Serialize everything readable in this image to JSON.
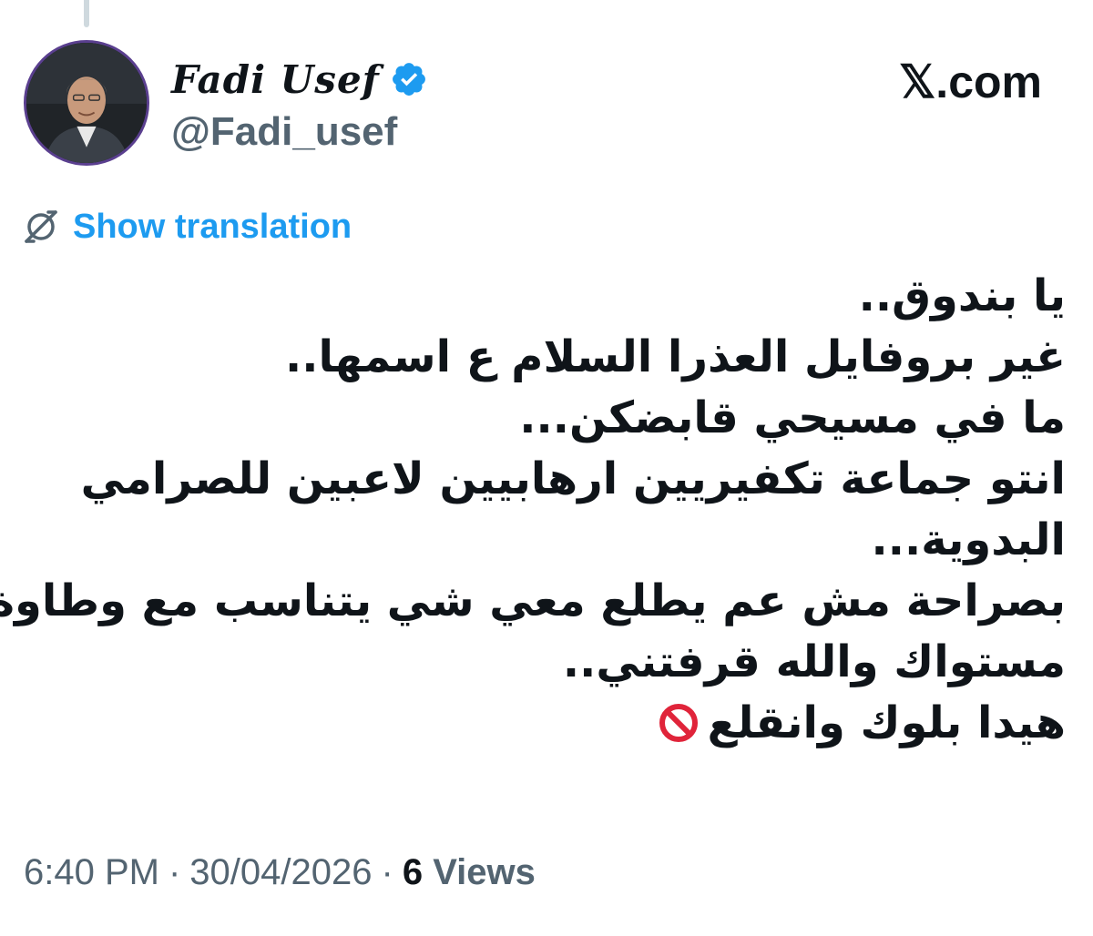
{
  "author": {
    "display_name": "Fadi Usef",
    "handle": "@Fadi_usef",
    "verified": true,
    "verified_icon": "verified-badge-icon",
    "avatar_icon": "profile-photo"
  },
  "brand": {
    "site": "𝕏.com"
  },
  "translation": {
    "label": "Show translation",
    "icon": "translate-icon"
  },
  "tweet": {
    "lines": [
      "يا بندوق..",
      "غير بروفايل العذرا السلام ع اسمها..",
      "ما في مسيحي قابضكن...",
      "انتو جماعة تكفيريين ارهابيين لاعبين للصرامي",
      "البدوية...",
      "بصراحة مش عم يطلع معي شي يتناسب مع وطاوة",
      "مستواك والله قرفتني..",
      "هيدا بلوك وانقلع"
    ],
    "trailing_emoji_icon": "prohibited-icon"
  },
  "meta": {
    "time": "6:40 PM",
    "separator": "·",
    "date": "30/04/2026",
    "views_count": "6",
    "views_label": "Views"
  },
  "colors": {
    "accent": "#1d9bf0",
    "secondary_text": "#536471",
    "primary_text": "#0f1419",
    "avatar_ring": "#5a3f8f"
  }
}
